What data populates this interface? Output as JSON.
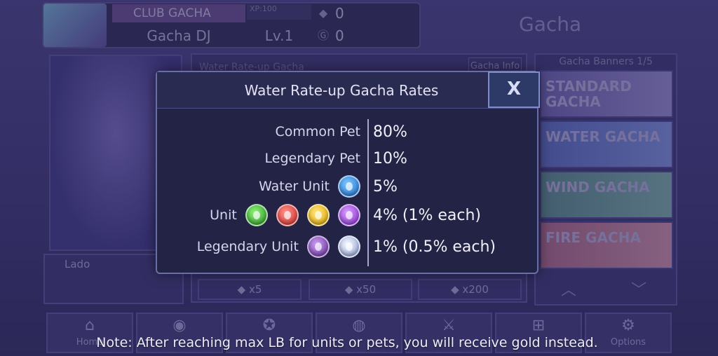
{
  "profile": {
    "club_name": "CLUB GACHA",
    "player_name": "Gacha DJ",
    "xp_label": "XP:100",
    "level": "Lv.1",
    "gems": "0",
    "gold": "0"
  },
  "screen_title": "Gacha",
  "gacha": {
    "panel_title": "Water Rate-up Gacha",
    "info_button": "Gacha Info",
    "character_name": "Lado",
    "pull_buttons": [
      "x5",
      "x50",
      "x200"
    ]
  },
  "banners": {
    "title": "Gacha Banners 1/5",
    "items": [
      {
        "name": "STANDARD GACHA"
      },
      {
        "name": "WATER GACHA"
      },
      {
        "name": "WIND GACHA"
      },
      {
        "name": "FIRE GACHA"
      }
    ]
  },
  "bottom_nav": {
    "items": [
      {
        "label": "Home",
        "icon": "home-icon"
      },
      {
        "label": "",
        "icon": "camera-icon"
      },
      {
        "label": "",
        "icon": "star-icon"
      },
      {
        "label": "",
        "icon": "orb-icon"
      },
      {
        "label": "",
        "icon": "swords-icon"
      },
      {
        "label": "",
        "icon": "gamepad-icon"
      },
      {
        "label": "Options",
        "icon": "gear-icon"
      }
    ]
  },
  "modal": {
    "title": "Water Rate-up Gacha Rates",
    "close_label": "X",
    "rows": [
      {
        "label": "Common Pet",
        "value": "80%",
        "orbs": []
      },
      {
        "label": "Legendary Pet",
        "value": "10%",
        "orbs": []
      },
      {
        "label": "Water Unit",
        "value": "5%",
        "orbs": [
          "water-orb-icon"
        ]
      },
      {
        "label": "Unit",
        "value": "4% (1% each)",
        "orbs": [
          "nature-orb-icon",
          "fire-orb-icon",
          "light-orb-icon",
          "dark-orb-icon"
        ]
      },
      {
        "label": "Legendary Unit",
        "value": "1% (0.5% each)",
        "orbs": [
          "shadow-orb-icon",
          "celestial-orb-icon"
        ]
      }
    ]
  },
  "note": "Note: After reaching max LB for units or pets, you will receive gold instead.",
  "colors": {
    "background": "#3a3569",
    "modal_bg": "#232445",
    "modal_border": "#6a6ea8",
    "close_bg": "#2d3a68"
  }
}
